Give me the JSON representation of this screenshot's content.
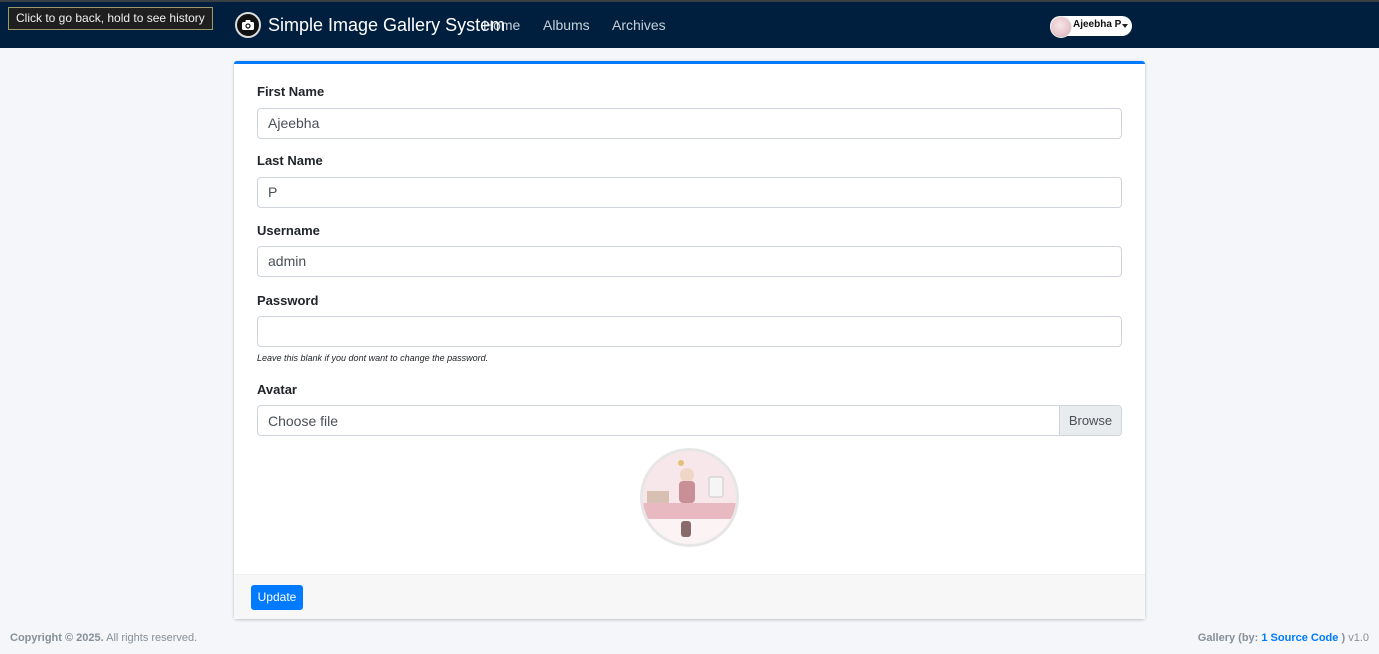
{
  "browser": {
    "tooltip": "Click to go back, hold to see history"
  },
  "navbar": {
    "brand": "Simple Image Gallery System",
    "brand_icon": "camera-icon",
    "links": [
      "Home",
      "Albums",
      "Archives"
    ],
    "user_name": "Ajeebha P",
    "colors": {
      "background": "#001f3f",
      "accent": "#007bff"
    }
  },
  "form": {
    "first_name_label": "First Name",
    "first_name_value": "Ajeebha",
    "last_name_label": "Last Name",
    "last_name_value": "P",
    "username_label": "Username",
    "username_value": "admin",
    "password_label": "Password",
    "password_value": "",
    "password_hint": "Leave this blank if you dont want to change the password.",
    "avatar_label": "Avatar",
    "file_placeholder": "Choose file",
    "browse_label": "Browse",
    "submit_label": "Update"
  },
  "footer": {
    "copyright_bold": "Copyright © 2025.",
    "copyright_rest": " All rights reserved.",
    "credit_prefix": "Gallery (by: ",
    "credit_link": "1 Source Code",
    "credit_suffix": " )",
    "version": " v1.0"
  }
}
